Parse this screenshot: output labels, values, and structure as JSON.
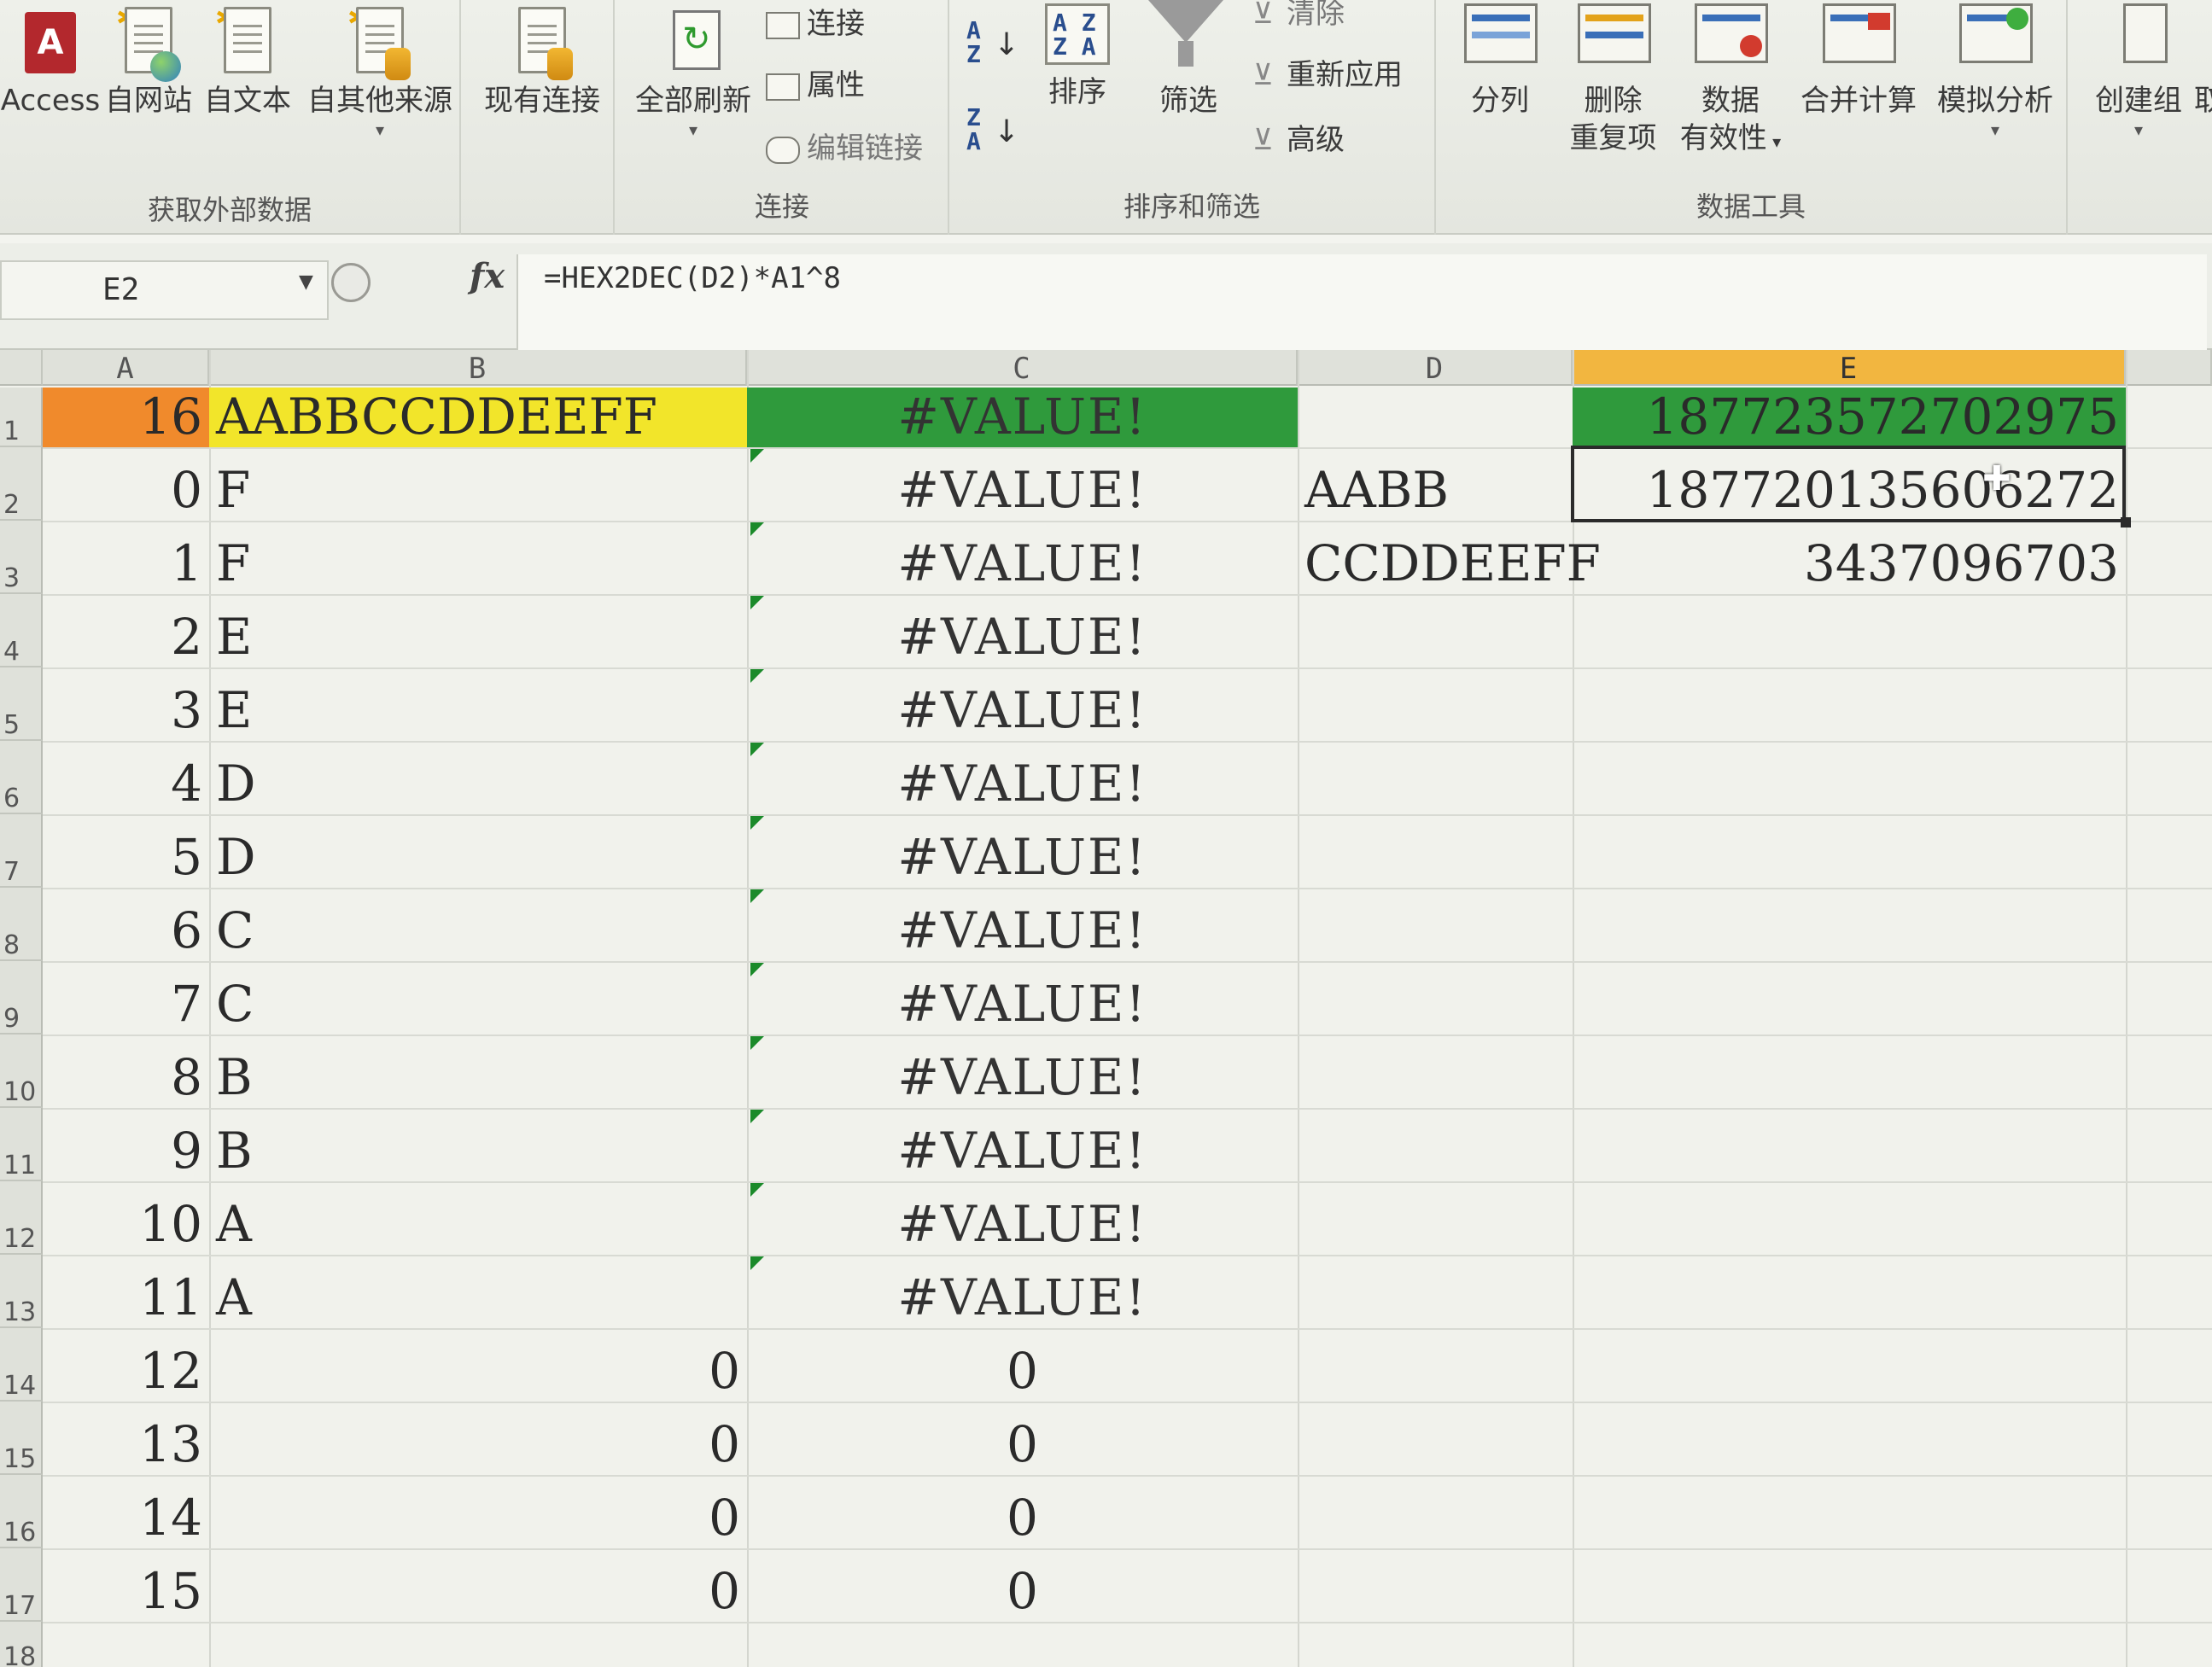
{
  "ribbon": {
    "groups": {
      "external": {
        "label": "获取外部数据",
        "access": "Access",
        "web": "自网站",
        "text": "自文本",
        "other": "自其他来源",
        "existing": "现有连接"
      },
      "connections": {
        "label": "连接",
        "refresh_all": "全部刷新",
        "connect": "连接",
        "properties": "属性",
        "edit_links": "编辑链接"
      },
      "sort_filter": {
        "label": "排序和筛选",
        "sort": "排序",
        "filter": "筛选",
        "clear": "清除",
        "reapply": "重新应用",
        "advanced": "高级"
      },
      "data_tools": {
        "label": "数据工具",
        "split": "分列",
        "remove_dup_1": "删除",
        "remove_dup_2": "重复项",
        "validation_1": "数据",
        "validation_2": "有效性",
        "consolidate": "合并计算",
        "whatif": "模拟分析"
      },
      "outline": {
        "group": "创建组",
        "ungroup_partial": "取"
      }
    }
  },
  "formula_bar": {
    "name_box": "E2",
    "fx": "fx",
    "formula": "=HEX2DEC(D2)*A1^8"
  },
  "sheet": {
    "columns": [
      "A",
      "B",
      "C",
      "D",
      "E"
    ],
    "row_numbers": [
      "1",
      "2",
      "3",
      "4",
      "5",
      "6",
      "7",
      "8",
      "9",
      "10",
      "11",
      "12",
      "13",
      "14",
      "15",
      "16",
      "17",
      "18"
    ],
    "rows": [
      {
        "a": "16",
        "b": "AABBCCDDEEFF",
        "c": "#VALUE!",
        "d": "",
        "e": "187723572702975"
      },
      {
        "a": "0",
        "b": "F",
        "c": "#VALUE!",
        "d": "AABB",
        "e": "187720135606272"
      },
      {
        "a": "1",
        "b": "F",
        "c": "#VALUE!",
        "d": "CCDDEEFF",
        "e": "3437096703"
      },
      {
        "a": "2",
        "b": "E",
        "c": "#VALUE!",
        "d": "",
        "e": ""
      },
      {
        "a": "3",
        "b": "E",
        "c": "#VALUE!",
        "d": "",
        "e": ""
      },
      {
        "a": "4",
        "b": "D",
        "c": "#VALUE!",
        "d": "",
        "e": ""
      },
      {
        "a": "5",
        "b": "D",
        "c": "#VALUE!",
        "d": "",
        "e": ""
      },
      {
        "a": "6",
        "b": "C",
        "c": "#VALUE!",
        "d": "",
        "e": ""
      },
      {
        "a": "7",
        "b": "C",
        "c": "#VALUE!",
        "d": "",
        "e": ""
      },
      {
        "a": "8",
        "b": "B",
        "c": "#VALUE!",
        "d": "",
        "e": ""
      },
      {
        "a": "9",
        "b": "B",
        "c": "#VALUE!",
        "d": "",
        "e": ""
      },
      {
        "a": "10",
        "b": "A",
        "c": "#VALUE!",
        "d": "",
        "e": ""
      },
      {
        "a": "11",
        "b": "A",
        "c": "#VALUE!",
        "d": "",
        "e": ""
      },
      {
        "a": "12",
        "b": "0",
        "c": "0",
        "d": "",
        "e": ""
      },
      {
        "a": "13",
        "b": "0",
        "c": "0",
        "d": "",
        "e": ""
      },
      {
        "a": "14",
        "b": "0",
        "c": "0",
        "d": "",
        "e": ""
      },
      {
        "a": "15",
        "b": "0",
        "c": "0",
        "d": "",
        "e": ""
      }
    ],
    "colors": {
      "a1_fill": "#f08a2c",
      "b1_fill": "#f2e52a",
      "c1_fill": "#2f9a3c",
      "e1_fill": "#2f9a3c",
      "header_selected": "#f2b640",
      "error_indicator": "#1b8a2a"
    }
  }
}
